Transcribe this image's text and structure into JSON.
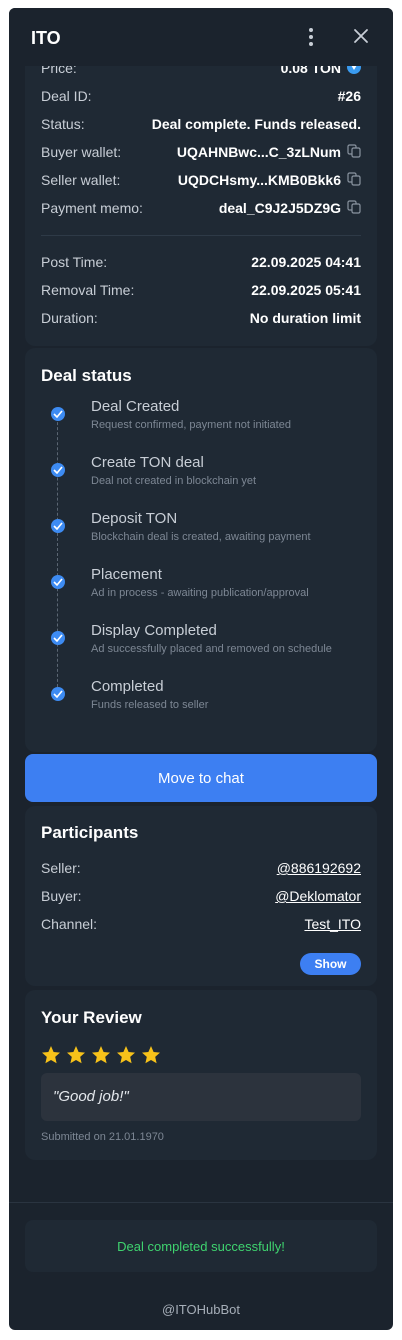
{
  "window": {
    "title": "ITO"
  },
  "details": {
    "price_label": "Price:",
    "price_value": "0.08 TON",
    "deal_id_label": "Deal ID:",
    "deal_id_value": "#26",
    "status_label": "Status:",
    "status_value": "Deal complete. Funds released.",
    "buyer_wallet_label": "Buyer wallet:",
    "buyer_wallet_value": "UQAHNBwc...C_3zLNum",
    "seller_wallet_label": "Seller wallet:",
    "seller_wallet_value": "UQDCHsmy...KMB0Bkk6",
    "payment_memo_label": "Payment memo:",
    "payment_memo_value": "deal_C9J2J5DZ9G",
    "post_time_label": "Post Time:",
    "post_time_value": "22.09.2025 04:41",
    "removal_time_label": "Removal Time:",
    "removal_time_value": "22.09.2025 05:41",
    "duration_label": "Duration:",
    "duration_value": "No duration limit"
  },
  "deal_status": {
    "title": "Deal status",
    "steps": [
      {
        "title": "Deal Created",
        "desc": "Request confirmed, payment not initiated"
      },
      {
        "title": "Create TON deal",
        "desc": "Deal not created in blockchain yet"
      },
      {
        "title": "Deposit TON",
        "desc": "Blockchain deal is created, awaiting payment"
      },
      {
        "title": "Placement",
        "desc": "Ad in process - awaiting publication/approval"
      },
      {
        "title": "Display Completed",
        "desc": "Ad successfully placed and removed on schedule"
      },
      {
        "title": "Completed",
        "desc": "Funds released to seller"
      }
    ]
  },
  "actions": {
    "move_to_chat": "Move to chat"
  },
  "participants": {
    "title": "Participants",
    "seller_label": "Seller:",
    "seller_value": "@886192692",
    "buyer_label": "Buyer:",
    "buyer_value": "@Deklomator",
    "channel_label": "Channel:",
    "channel_value": "Test_ITO",
    "show_label": "Show"
  },
  "review": {
    "title": "Your Review",
    "rating": 5,
    "text": "\"Good job!\"",
    "submitted": "Submitted on 21.01.1970"
  },
  "footer": {
    "success_message": "Deal completed successfully!",
    "bot_handle": "@ITOHubBot"
  },
  "colors": {
    "background": "#1b232d",
    "card": "#1f2934",
    "accent": "#3d7ff2",
    "link": "#3a9bf0",
    "success": "#3fd36f",
    "star": "#f7c21a"
  }
}
